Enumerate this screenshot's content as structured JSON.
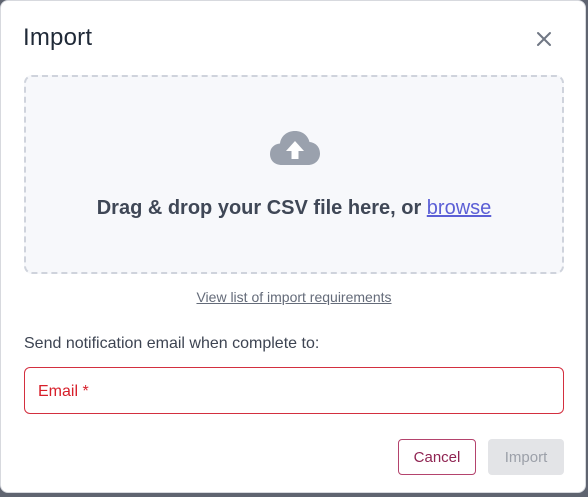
{
  "dialog": {
    "title": "Import",
    "close_icon": "close-icon",
    "dropzone": {
      "icon": "cloud-upload-icon",
      "prompt": "Drag & drop your CSV file here, or ",
      "browse_label": "browse"
    },
    "requirements_link": "View list of import requirements",
    "notification": {
      "label": "Send notification email when complete to:",
      "email_label": "Email",
      "required_mark": "*"
    },
    "actions": {
      "cancel_label": "Cancel",
      "import_label": "Import",
      "import_disabled": true
    },
    "colors": {
      "link": "#5b5fd6",
      "error": "#d71f2a",
      "cancel_accent": "#8f2452",
      "disabled_bg": "#e3e4e7"
    }
  }
}
